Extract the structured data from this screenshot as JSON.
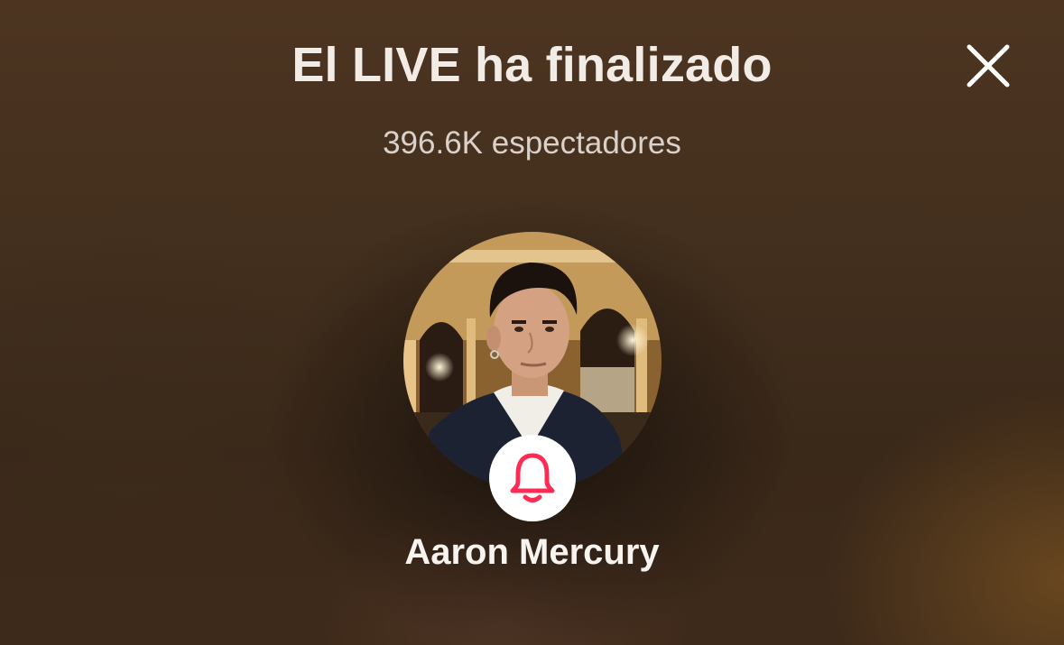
{
  "header": {
    "title": "El LIVE ha finalizado",
    "close_icon": "close-icon"
  },
  "stats": {
    "viewers_text": "396.6K espectadores"
  },
  "host": {
    "name": "Aaron Mercury",
    "avatar_description_icon": "avatar-photo",
    "follow_icon": "bell-icon"
  },
  "colors": {
    "accent": "#fe2c55",
    "title": "#f2ece6",
    "subtitle": "#d9d1ca"
  }
}
